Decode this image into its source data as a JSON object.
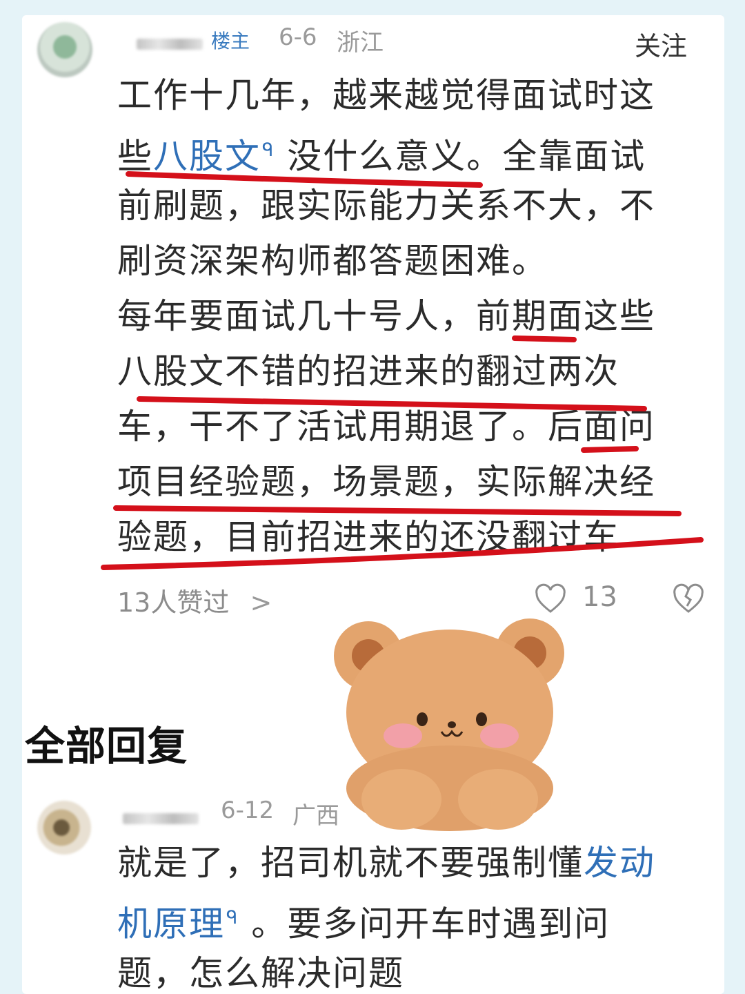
{
  "post": {
    "op_badge": "楼主",
    "date": "6-6",
    "location": "浙江",
    "follow_label": "关注",
    "lines": [
      {
        "pre": "工作十几年，越来越觉得面试时这",
        "link": "",
        "post": ""
      },
      {
        "pre": "些",
        "link": "八股文",
        "post": " 没什么意义。全靠面试"
      },
      {
        "pre": "前刷题，跟实际能力关系不大，不",
        "link": "",
        "post": ""
      },
      {
        "pre": "刷资深架构师都答题困难。",
        "link": "",
        "post": ""
      },
      {
        "pre": "每年要面试几十号人，前期面这些",
        "link": "",
        "post": ""
      },
      {
        "pre": "八股文不错的招进来的翻过两次",
        "link": "",
        "post": ""
      },
      {
        "pre": "车，干不了活试用期退了。后面问",
        "link": "",
        "post": ""
      },
      {
        "pre": "项目经验题，场景题，实际解决经",
        "link": "",
        "post": ""
      },
      {
        "pre": "验题，目前招进来的还没翻过车",
        "link": "",
        "post": ""
      }
    ],
    "likes_text": "13人赞过",
    "chevron": ">",
    "like_count": "13",
    "icons": {
      "search_link": "search-icon",
      "heart": "heart-icon",
      "dislike": "broken-heart-icon",
      "chevron": "chevron-right-icon"
    }
  },
  "section_title": "全部回复",
  "reply": {
    "date": "6-12",
    "location": "广西",
    "lines": [
      {
        "pre": "就是了，招司机就不要强制懂",
        "link": "发动",
        "post": ""
      },
      {
        "pre": "",
        "link": "机原理",
        "post": " 。要多问开车时遇到问"
      },
      {
        "pre": "题，怎么解决问题",
        "link": "",
        "post": ""
      }
    ]
  },
  "colors": {
    "link": "#2f6fb7",
    "annotation_red": "#d4101a",
    "background": "#e5f3f8",
    "bear": "#e0a06a"
  }
}
